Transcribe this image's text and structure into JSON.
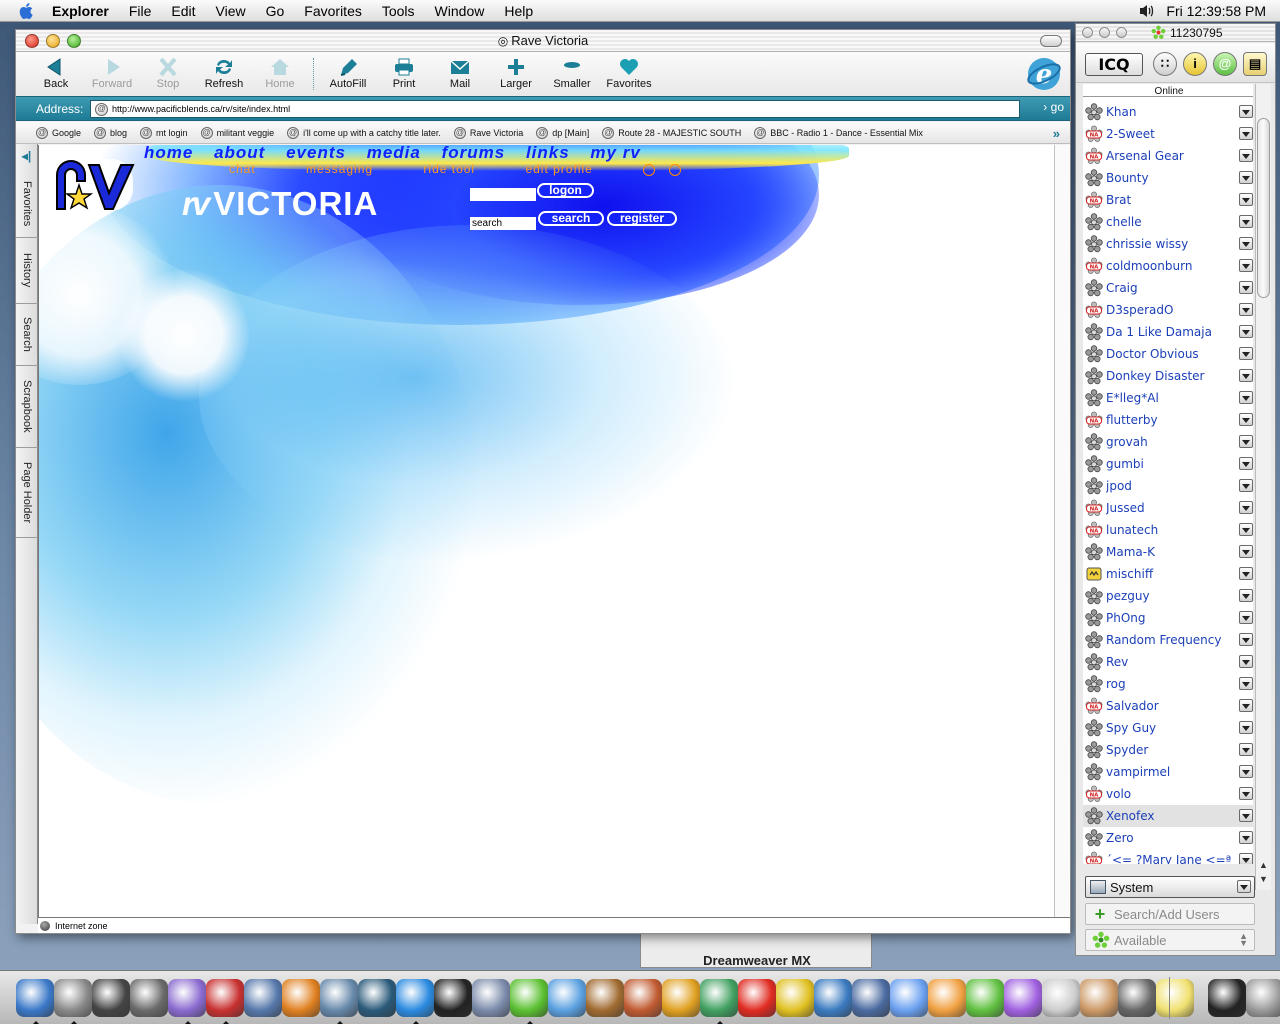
{
  "menubar": {
    "app_name": "Explorer",
    "menus": [
      "File",
      "Edit",
      "View",
      "Go",
      "Favorites",
      "Tools",
      "Window",
      "Help"
    ],
    "clock": "Fri 12:39:58 PM"
  },
  "browser": {
    "window_title": "Rave Victoria",
    "toolbar": [
      {
        "label": "Back",
        "icon": "back-arrow-icon",
        "enabled": true
      },
      {
        "label": "Forward",
        "icon": "forward-arrow-icon",
        "enabled": false
      },
      {
        "label": "Stop",
        "icon": "stop-x-icon",
        "enabled": false
      },
      {
        "label": "Refresh",
        "icon": "refresh-icon",
        "enabled": true
      },
      {
        "label": "Home",
        "icon": "home-icon",
        "enabled": false
      },
      {
        "label": "AutoFill",
        "icon": "autofill-icon",
        "enabled": true
      },
      {
        "label": "Print",
        "icon": "printer-icon",
        "enabled": true
      },
      {
        "label": "Mail",
        "icon": "mail-icon",
        "enabled": true
      },
      {
        "label": "Larger",
        "icon": "larger-icon",
        "enabled": true
      },
      {
        "label": "Smaller",
        "icon": "smaller-icon",
        "enabled": true
      },
      {
        "label": "Favorites",
        "icon": "heart-icon",
        "enabled": true
      }
    ],
    "address_label": "Address:",
    "address_url": "http://www.pacificblends.ca/rv/site/index.html",
    "go_label": "go",
    "favorites": [
      "Google",
      "blog",
      "mt login",
      "militant veggie",
      "i'll come up with a catchy title later.",
      "Rave Victoria",
      "dp [Main]",
      "Route 28 - MAJESTIC SOUTH",
      "BBC - Radio 1 - Dance - Essential Mix"
    ],
    "side_tabs": [
      "Favorites",
      "History",
      "Search",
      "Scrapbook",
      "Page Holder"
    ],
    "status_text": "Internet zone",
    "accent_color": "#1e7b95"
  },
  "site": {
    "nav": [
      "home",
      "about",
      "events",
      "media",
      "forums",
      "links",
      "my rv"
    ],
    "subnav": [
      "chat",
      "messaging",
      "ride tool",
      "edit profile"
    ],
    "logo_text": "rv",
    "wordmark_mark": "rv",
    "wordmark_text": "VICTORIA",
    "search_value": "search",
    "logon_label": "logon",
    "search_label": "search",
    "register_label": "register",
    "nav_color": "#1020ff",
    "subnav_color": "#ff9a1a"
  },
  "icq": {
    "uin": "11230795",
    "logo_label": "ICQ",
    "online_label": "Online",
    "contacts": [
      {
        "name": "Khan",
        "status": "online"
      },
      {
        "name": "2-Sweet",
        "status": "na"
      },
      {
        "name": "Arsenal Gear",
        "status": "na"
      },
      {
        "name": "Bounty",
        "status": "online"
      },
      {
        "name": "Brat",
        "status": "na"
      },
      {
        "name": "chelle",
        "status": "online"
      },
      {
        "name": "chrissie wissy",
        "status": "online"
      },
      {
        "name": "coldmoonburn",
        "status": "na"
      },
      {
        "name": "Craig",
        "status": "online"
      },
      {
        "name": "D3speradO",
        "status": "na"
      },
      {
        "name": "Da 1 Like Damaja",
        "status": "online"
      },
      {
        "name": "Doctor Obvious",
        "status": "online"
      },
      {
        "name": "Donkey Disaster",
        "status": "online"
      },
      {
        "name": "E*lleg*Al",
        "status": "online"
      },
      {
        "name": "flutterby",
        "status": "na"
      },
      {
        "name": "grovah",
        "status": "online"
      },
      {
        "name": "gumbi",
        "status": "online"
      },
      {
        "name": "jpod",
        "status": "online"
      },
      {
        "name": "Jussed",
        "status": "na"
      },
      {
        "name": "lunatech",
        "status": "na"
      },
      {
        "name": "Mama-K",
        "status": "online"
      },
      {
        "name": "mischiff",
        "status": "occupied"
      },
      {
        "name": "pezguy",
        "status": "online"
      },
      {
        "name": "PhOng",
        "status": "online"
      },
      {
        "name": "Random Frequency",
        "status": "online"
      },
      {
        "name": "Rev",
        "status": "online"
      },
      {
        "name": "rog",
        "status": "online"
      },
      {
        "name": "Salvador",
        "status": "na"
      },
      {
        "name": "Spy Guy",
        "status": "online"
      },
      {
        "name": "Spyder",
        "status": "online"
      },
      {
        "name": "vampirmel",
        "status": "online"
      },
      {
        "name": "volo",
        "status": "na"
      },
      {
        "name": "Xenofex",
        "status": "online",
        "highlight": true
      },
      {
        "name": "Zero",
        "status": "online"
      },
      {
        "name": "´<= ?Mary Jane <=ª",
        "status": "na"
      }
    ],
    "system_label": "System",
    "search_add_label": "Search/Add Users",
    "status_label": "Available"
  },
  "background_window_title": "Dreamweaver MX",
  "dock": {
    "items": [
      {
        "icon": "finder-icon",
        "color": "#3a78c8",
        "running": true
      },
      {
        "icon": "stopwatch-icon",
        "color": "#888888",
        "running": true
      },
      {
        "icon": "sherlock-icon",
        "color": "#444444",
        "running": false
      },
      {
        "icon": "apple-icon",
        "color": "#6a6a6a",
        "running": false
      },
      {
        "icon": "itunes-icon",
        "color": "#8a6ad0",
        "running": true
      },
      {
        "icon": "iphoto-icon",
        "color": "#c83030",
        "running": true
      },
      {
        "icon": "eye-icon",
        "color": "#5577aa",
        "running": false
      },
      {
        "icon": "reason-icon",
        "color": "#e08020",
        "running": false
      },
      {
        "icon": "installer-icon",
        "color": "#6688aa",
        "running": true
      },
      {
        "icon": "netscape-icon",
        "color": "#2a5a7a",
        "running": false
      },
      {
        "icon": "internet-explorer-icon",
        "color": "#2a8ae0",
        "running": true
      },
      {
        "icon": "terminal-icon",
        "color": "#222222",
        "running": false
      },
      {
        "icon": "network-icon",
        "color": "#7a8aaa",
        "running": false
      },
      {
        "icon": "icq-flower-icon",
        "color": "#5ac030",
        "running": true
      },
      {
        "icon": "messenger-icon",
        "color": "#5aa0e0",
        "running": false
      },
      {
        "icon": "dog-icon",
        "color": "#a06a30",
        "running": false
      },
      {
        "icon": "cube-icon",
        "color": "#c05a30",
        "running": false
      },
      {
        "icon": "tile-icon",
        "color": "#e0a020",
        "running": false
      },
      {
        "icon": "dreamweaver-icon",
        "color": "#40a060",
        "running": true
      },
      {
        "icon": "flash-icon",
        "color": "#e02a20",
        "running": false
      },
      {
        "icon": "freehand-icon",
        "color": "#e0c020",
        "running": false
      },
      {
        "icon": "fontographer-icon",
        "color": "#3a7ac0",
        "running": false
      },
      {
        "icon": "audio-icon",
        "color": "#4a6aa0",
        "running": false
      },
      {
        "icon": "app-w-icon",
        "color": "#6aa0f0",
        "running": false
      },
      {
        "icon": "app-p-icon",
        "color": "#f0a040",
        "running": false
      },
      {
        "icon": "app-y-icon",
        "color": "#60c040",
        "running": false
      },
      {
        "icon": "app-e-icon",
        "color": "#a060e0",
        "running": false
      },
      {
        "icon": "text-editor-icon",
        "color": "#cccccc",
        "running": false
      },
      {
        "icon": "pen-icon",
        "color": "#cc9966",
        "running": false
      },
      {
        "icon": "unreal-icon",
        "color": "#666666",
        "running": false
      },
      {
        "icon": "lightbulb-icon",
        "color": "#f0e070",
        "running": false
      },
      {
        "icon": "console-icon",
        "color": "#222222",
        "running": false
      },
      {
        "icon": "trash-icon",
        "color": "#999999",
        "running": false
      }
    ]
  }
}
